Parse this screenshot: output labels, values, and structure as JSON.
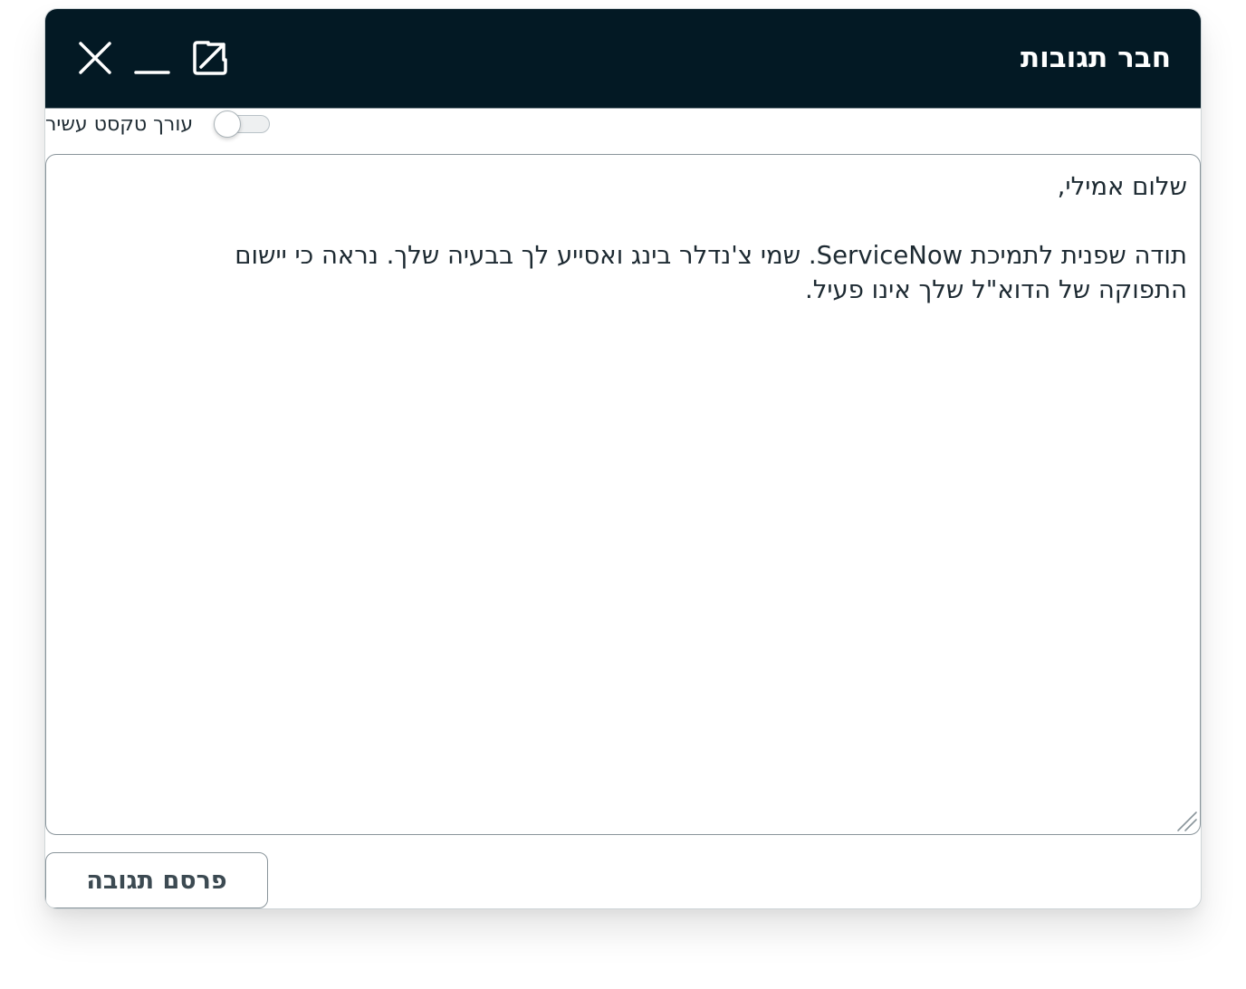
{
  "composer": {
    "title": "חבר תגובות",
    "buttons": {
      "close_icon": "close-icon",
      "minimize_icon": "minimize-icon",
      "popout_icon": "popout-icon"
    },
    "colors": {
      "header_bg": "#031924",
      "header_text": "#ffffff",
      "body_text": "#1d2a32",
      "border": "#8a959b"
    }
  },
  "rich_text_toggle": {
    "label": "עורך טקסט עשיר",
    "state": "off"
  },
  "reply": {
    "greeting": "שלום אמילי,",
    "body_line_1": "תודה שפנית לתמיכת ServiceNow. שמי צ'נדלר בינג ואסייע לך בבעיה שלך. נראה כי יישום",
    "body_line_2": "התפוקה של הדוא\"ל שלך אינו פעיל."
  },
  "footer": {
    "post_label": "פרסם תגובה"
  }
}
